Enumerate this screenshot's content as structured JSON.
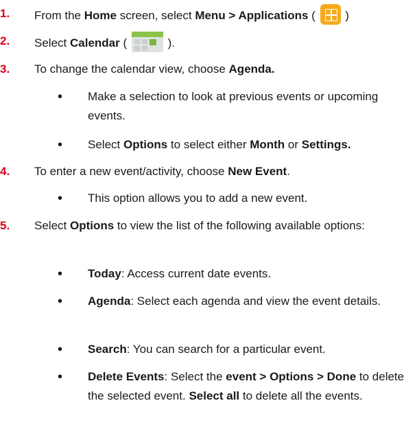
{
  "steps": [
    {
      "num": "1.",
      "parts": [
        "From the ",
        "Home",
        " screen, select ",
        "Menu > Applications",
        " ( ",
        " )"
      ]
    },
    {
      "num": "2.",
      "parts": [
        "Select ",
        "Calendar",
        " ( ",
        " )."
      ]
    },
    {
      "num": "3.",
      "parts": [
        "To change the calendar view, choose ",
        "Agenda."
      ]
    },
    {
      "num": "4.",
      "parts": [
        "To enter a new event/activity, choose ",
        "New Event",
        "."
      ]
    },
    {
      "num": "5.",
      "parts": [
        "Select ",
        "Options",
        " to view the list of the following available options:"
      ]
    }
  ],
  "bullets": {
    "b3a": "Make a selection to look at previous events or upcoming events.",
    "b3b": [
      "Select ",
      "Options",
      " to select either ",
      "Month",
      " or ",
      "Settings."
    ],
    "b4a": "This option allows you to add a new event.",
    "b5a": [
      "Today",
      ": Access current date events."
    ],
    "b5b": [
      "Agenda",
      ": Select each agenda and view the event details."
    ],
    "b5c": [
      "Search",
      ": You can search for a particular event."
    ],
    "b5d": [
      "Delete Events",
      ": Select the ",
      "event > Options > Done",
      " to delete the selected event. ",
      "Select all",
      " to delete all the events."
    ]
  },
  "icons": {
    "apps": "applications-grid-icon",
    "calendar": "calendar-app-icon"
  },
  "colors": {
    "step_number": "#d9001b",
    "apps_icon": "#f6a91a",
    "text": "#1a1a1a"
  }
}
